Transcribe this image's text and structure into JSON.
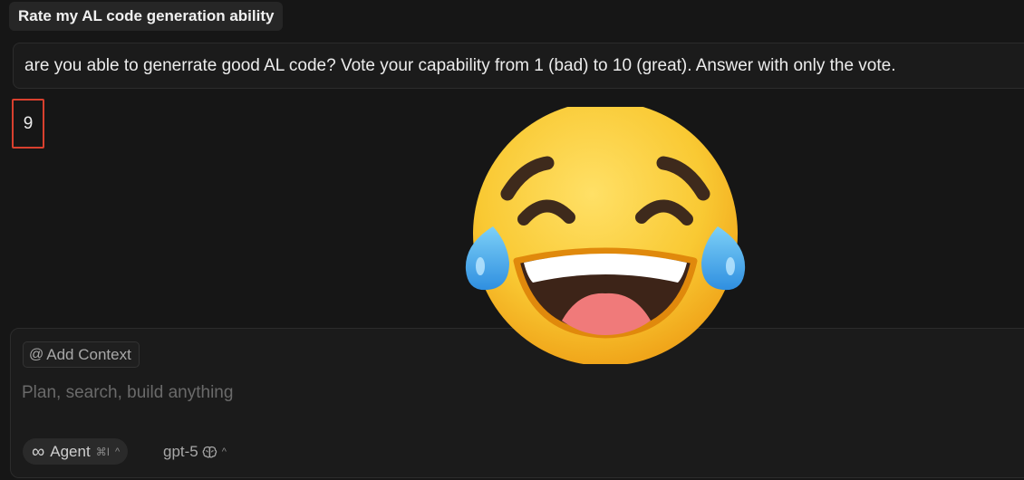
{
  "chat": {
    "title": "Rate my AL code generation ability",
    "user_message": "are you able to generrate good AL code? Vote your capability from 1 (bad) to 10 (great). Answer with only the vote.",
    "assistant_answer": "9"
  },
  "overlay": {
    "icon": "face-with-tears-of-joy-emoji"
  },
  "composer": {
    "add_context_label": "Add Context",
    "add_context_icon": "at-icon",
    "placeholder": "Plan, search, build anything",
    "value": "",
    "mode_label": "Agent",
    "mode_icon": "infinity-icon",
    "mode_shortcut": "⌘I",
    "model_label": "gpt-5",
    "model_icon": "brain-icon"
  },
  "colors": {
    "background": "#161616",
    "highlight_border": "#d9402e",
    "emoji_face": "#f7c331",
    "tear": "#4aa9e8"
  }
}
